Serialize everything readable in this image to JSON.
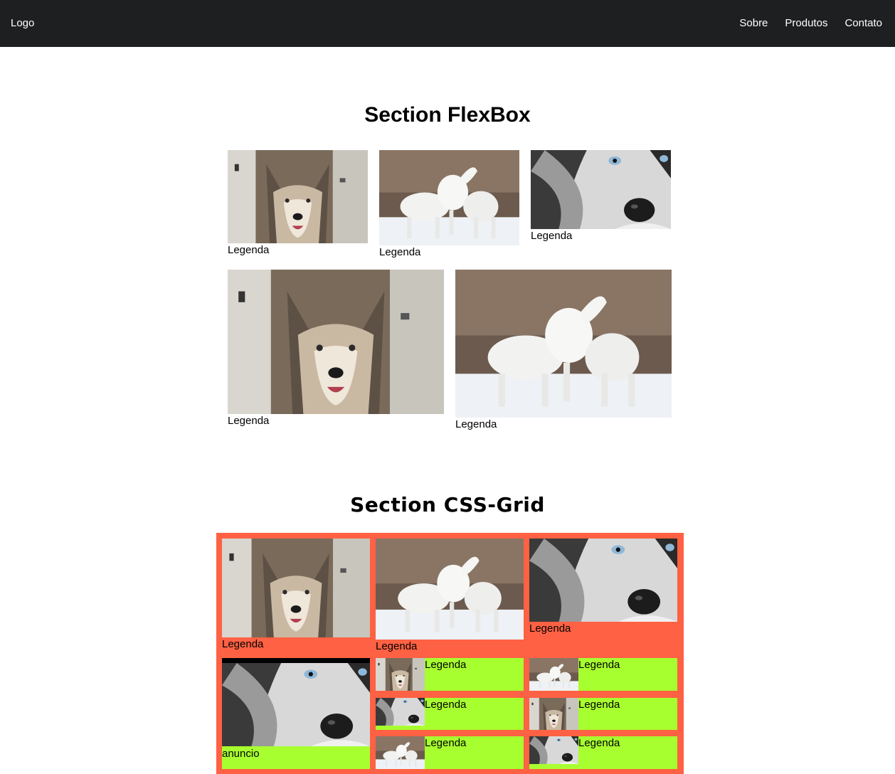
{
  "header": {
    "logo": "Logo",
    "nav": [
      "Sobre",
      "Produtos",
      "Contato"
    ]
  },
  "flex_section": {
    "title": "Section FlexBox",
    "captions": [
      "Legenda",
      "Legenda",
      "Legenda",
      "Legenda",
      "Legenda"
    ]
  },
  "grid_section": {
    "title": "Section CSS-Grid",
    "captions": [
      "Legenda",
      "Legenda",
      "Legenda"
    ],
    "ad_label": "anuncio",
    "small_captions": [
      "Legenda",
      "Legenda",
      "Legenda",
      "Legenda",
      "Legenda",
      "Legenda"
    ]
  },
  "icons": {
    "wolf_gray": "gray-wolf-photo",
    "wolves_white": "white-wolves-photo",
    "husky": "husky-closeup-photo"
  },
  "colors": {
    "header_bg": "#1e1f21",
    "grid_bg": "#fe6143",
    "grid_item_bg": "#a8ff2f"
  }
}
